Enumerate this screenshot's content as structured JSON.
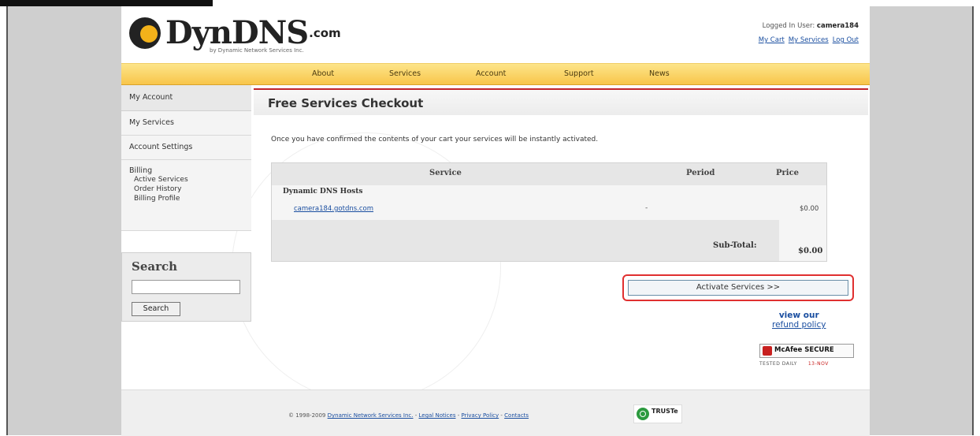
{
  "header": {
    "logo_name": "DynDNS",
    "logo_suffix": ".com",
    "logo_tagline": "by Dynamic Network Services Inc.",
    "logged_in_label": "Logged In User:",
    "logged_in_user": "camera184",
    "links": [
      "My Cart",
      "My Services",
      "Log Out"
    ]
  },
  "nav": {
    "items": [
      "About",
      "Services",
      "Account",
      "Support",
      "News"
    ]
  },
  "sidebar": {
    "heading": "My Account",
    "items": [
      "My Services",
      "Account Settings"
    ],
    "billing_label": "Billing",
    "billing_items": [
      "Active Services",
      "Order History",
      "Billing Profile"
    ]
  },
  "search": {
    "title": "Search",
    "placeholder": "",
    "button_label": "Search"
  },
  "main": {
    "title": "Free Services Checkout",
    "intro": "Once you have confirmed the contents of your cart your services will be instantly activated.",
    "table": {
      "headers": [
        "Service",
        "Period",
        "Price"
      ],
      "group": "Dynamic DNS Hosts",
      "rows": [
        {
          "service": "camera184.gotdns.com",
          "period": "-",
          "price": "$0.00"
        }
      ],
      "subtotal_label": "Sub-Total:",
      "subtotal_value": "$0.00"
    },
    "activate_button": "Activate Services >>",
    "refund_line1": "view our",
    "refund_line2": "refund policy",
    "mcafee": "McAfee SECURE",
    "mcafee_sub_left": "TESTED DAILY",
    "mcafee_sub_right": "13-NOV"
  },
  "footer": {
    "copyright": "© 1998-2009",
    "company_link": "Dynamic Network Services Inc.",
    "links": [
      "Legal Notices",
      "Privacy Policy",
      "Contacts"
    ],
    "separator": " - ",
    "truste": "TRUSTe"
  },
  "colors": {
    "accent_red": "#c0252b",
    "nav_yellow": "#f8c54a",
    "link_blue": "#1a4ea0",
    "highlight_red": "#e03030"
  },
  "icons": {
    "logo": "dyndns-logo-icon",
    "mcafee": "mcafee-shield-icon",
    "truste": "truste-seal-icon"
  }
}
